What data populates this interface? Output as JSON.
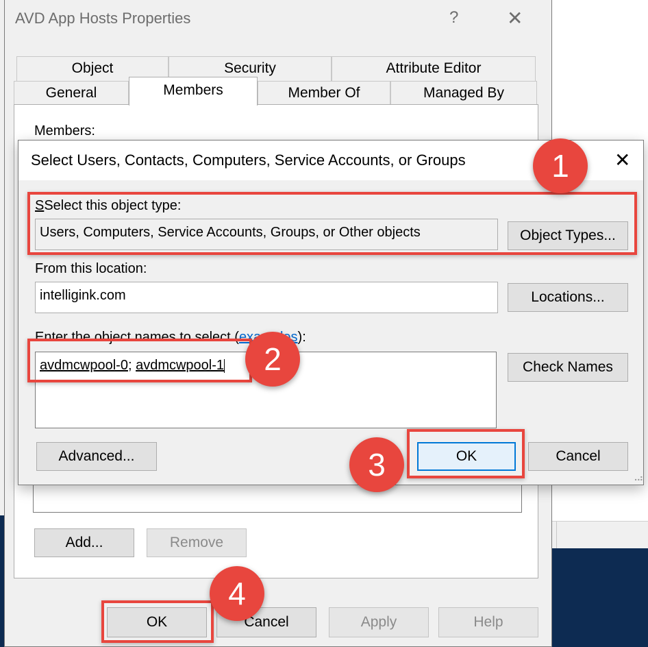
{
  "properties_window": {
    "title": "AVD App Hosts Properties",
    "help_glyph": "?",
    "close_glyph": "✕",
    "tabs_row1": [
      "Object",
      "Security",
      "Attribute Editor"
    ],
    "tabs_row2": [
      "General",
      "Members",
      "Member Of",
      "Managed By"
    ],
    "active_tab": "Members",
    "members_label": "Members:",
    "add_button": "Add...",
    "remove_button": "Remove",
    "ok_button": "OK",
    "cancel_button": "Cancel",
    "apply_button": "Apply",
    "help_button": "Help"
  },
  "select_dialog": {
    "title": "Select Users, Contacts, Computers, Service Accounts, or Groups",
    "close_glyph": "✕",
    "object_type_label": "Select this object type:",
    "object_type_value": "Users, Computers, Service Accounts, Groups, or Other objects",
    "object_types_button": "Object Types...",
    "location_label": "From this location:",
    "location_value": "intelligink.com",
    "locations_button": "Locations...",
    "names_label": "Enter the object names to select (",
    "names_link": "examples",
    "names_label_end": "):",
    "names_entry_1": "avdmcwpool-0",
    "names_separator": "; ",
    "names_entry_2": "avdmcwpool-1",
    "check_names_button": "Check Names",
    "advanced_button": "Advanced...",
    "ok_button": "OK",
    "cancel_button": "Cancel"
  },
  "annotations": {
    "badge_1": "1",
    "badge_2": "2",
    "badge_3": "3",
    "badge_4": "4",
    "highlight_color": "#e8463e"
  },
  "colors": {
    "dialog_background": "#f0f0f0",
    "focus_blue": "#0078d7",
    "desktop_navy": "#0d2b52"
  }
}
